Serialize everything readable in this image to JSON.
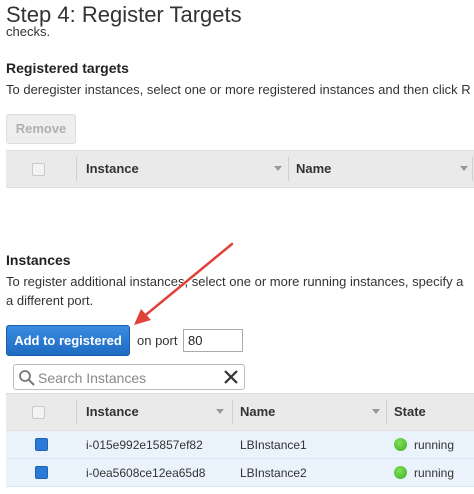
{
  "page": {
    "title": "Step 4: Register Targets",
    "title_suffix": "checks."
  },
  "registered": {
    "heading": "Registered targets",
    "description": "To deregister instances, select one or more registered instances and then click R",
    "remove_label": "Remove",
    "columns": [
      "Instance",
      "Name"
    ]
  },
  "instances": {
    "heading": "Instances",
    "description_line1": "To register additional instances, select one or more running instances, specify a",
    "description_line2": "a different port.",
    "add_label": "Add to registered",
    "on_port_label": "on port",
    "port_value": "80",
    "search_placeholder": "Search Instances",
    "columns": [
      "Instance",
      "Name",
      "State"
    ],
    "rows": [
      {
        "instance": "i-015e992e15857ef82",
        "name": "LBInstance1",
        "state": "running",
        "selected": true
      },
      {
        "instance": "i-0ea5608ce12ea65d8",
        "name": "LBInstance2",
        "state": "running",
        "selected": true
      }
    ]
  },
  "colors": {
    "primary_button": "#1f6cc3",
    "annotation_arrow": "#e0413a",
    "running_status": "#3fae1f"
  }
}
